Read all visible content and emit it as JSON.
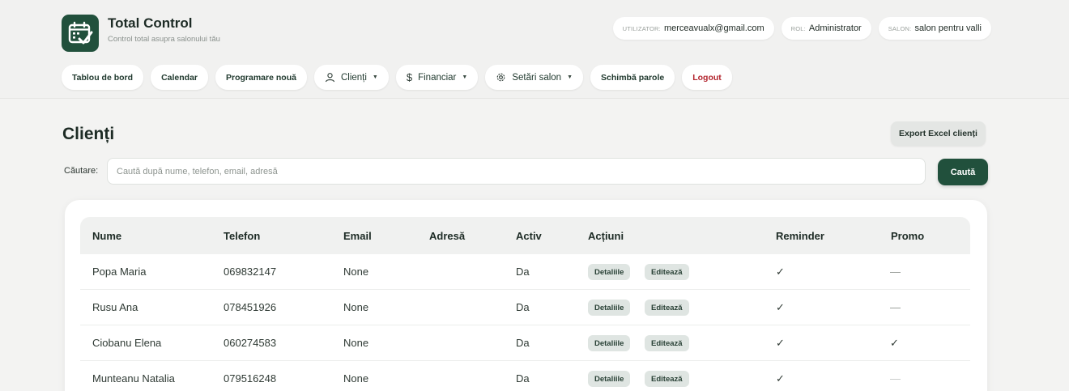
{
  "brand": {
    "title": "Total Control",
    "subtitle": "Control total asupra salonului tău"
  },
  "info": [
    {
      "label": "UTILIZATOR:",
      "value": "merceavualx@gmail.com"
    },
    {
      "label": "ROL:",
      "value": "Administrator"
    },
    {
      "label": "SALON:",
      "value": "salon pentru valli"
    }
  ],
  "nav": {
    "dashboard": "Tablou de bord",
    "calendar": "Calendar",
    "new_appointment": "Programare nouă",
    "clients": "Clienți",
    "financial": "Financiar",
    "salon_settings": "Setări salon",
    "change_passwords": "Schimbă parole",
    "logout": "Logout"
  },
  "page": {
    "title": "Clienți",
    "export_label": "Export Excel clienți"
  },
  "search": {
    "label": "Căutare:",
    "placeholder": "Caută după nume, telefon, email, adresă",
    "value": "",
    "button_label": "Caută"
  },
  "table": {
    "columns": [
      "Nume",
      "Telefon",
      "Email",
      "Adresă",
      "Activ",
      "Acțiuni",
      "Reminder",
      "Promo"
    ],
    "details_label": "Detaliile",
    "edit_label": "Editează",
    "rows": [
      {
        "name": "Popa Maria",
        "phone": "069832147",
        "email": "None",
        "address": "",
        "active": "Da",
        "reminder": "✓",
        "promo": "—"
      },
      {
        "name": "Rusu Ana",
        "phone": "078451926",
        "email": "None",
        "address": "",
        "active": "Da",
        "reminder": "✓",
        "promo": "—"
      },
      {
        "name": "Ciobanu Elena",
        "phone": "060274583",
        "email": "None",
        "address": "",
        "active": "Da",
        "reminder": "✓",
        "promo": "✓"
      },
      {
        "name": "Munteanu Natalia",
        "phone": "079516248",
        "email": "None",
        "address": "",
        "active": "Da",
        "reminder": "✓",
        "promo": "—"
      }
    ]
  },
  "colors": {
    "brand": "#21503c",
    "logout": "#b3262f",
    "background": "#f3f3f2"
  },
  "icons": {
    "logo": "calendar-check-icon",
    "clients": "user-icon",
    "financial": "dollar-icon",
    "settings": "gear-icon",
    "dropdown": "caret-down-icon"
  }
}
